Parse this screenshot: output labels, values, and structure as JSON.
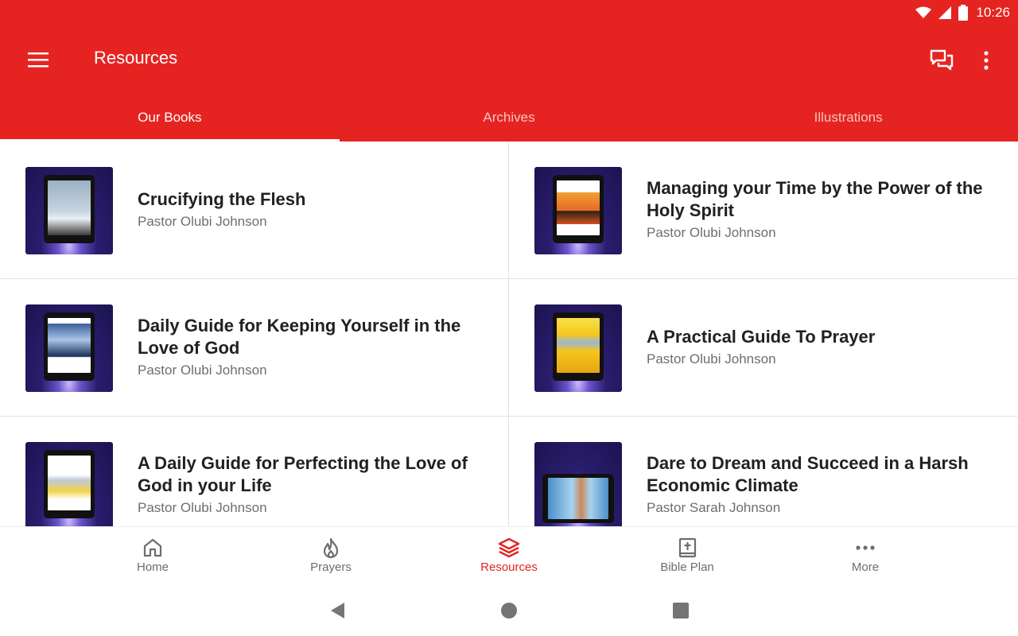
{
  "status_bar": {
    "time": "10:26",
    "icons": [
      "wifi-icon",
      "signal-icon",
      "battery-icon"
    ]
  },
  "app_bar": {
    "title": "Resources",
    "icons": [
      "menu-icon",
      "chat-icon",
      "more-vert-icon"
    ]
  },
  "tabs": [
    {
      "label": "Our Books",
      "active": true
    },
    {
      "label": "Archives",
      "active": false
    },
    {
      "label": "Illustrations",
      "active": false
    }
  ],
  "books": [
    {
      "title": "Crucifying the Flesh",
      "author": "Pastor Olubi Johnson"
    },
    {
      "title": "Managing your Time by the Power of the Holy Spirit",
      "author": "Pastor Olubi Johnson"
    },
    {
      "title": "Daily Guide for Keeping Yourself in the Love of God",
      "author": "Pastor Olubi Johnson"
    },
    {
      "title": "A Practical Guide To Prayer",
      "author": "Pastor Olubi Johnson"
    },
    {
      "title": "A Daily Guide for Perfecting the Love of God in your Life",
      "author": "Pastor Olubi Johnson"
    },
    {
      "title": "Dare to Dream and Succeed in a Harsh Economic Climate",
      "author": "Pastor Sarah Johnson"
    }
  ],
  "bottom_nav": [
    {
      "label": "Home",
      "icon": "home-icon",
      "active": false
    },
    {
      "label": "Prayers",
      "icon": "flame-icon",
      "active": false
    },
    {
      "label": "Resources",
      "icon": "layers-icon",
      "active": true
    },
    {
      "label": "Bible Plan",
      "icon": "bible-icon",
      "active": false
    },
    {
      "label": "More",
      "icon": "more-horiz-icon",
      "active": false
    }
  ],
  "system_nav": [
    "back-icon",
    "home-circle-icon",
    "recents-icon"
  ],
  "colors": {
    "primary": "#e52421",
    "text_primary": "#212121",
    "text_secondary": "#6e6e6e"
  }
}
